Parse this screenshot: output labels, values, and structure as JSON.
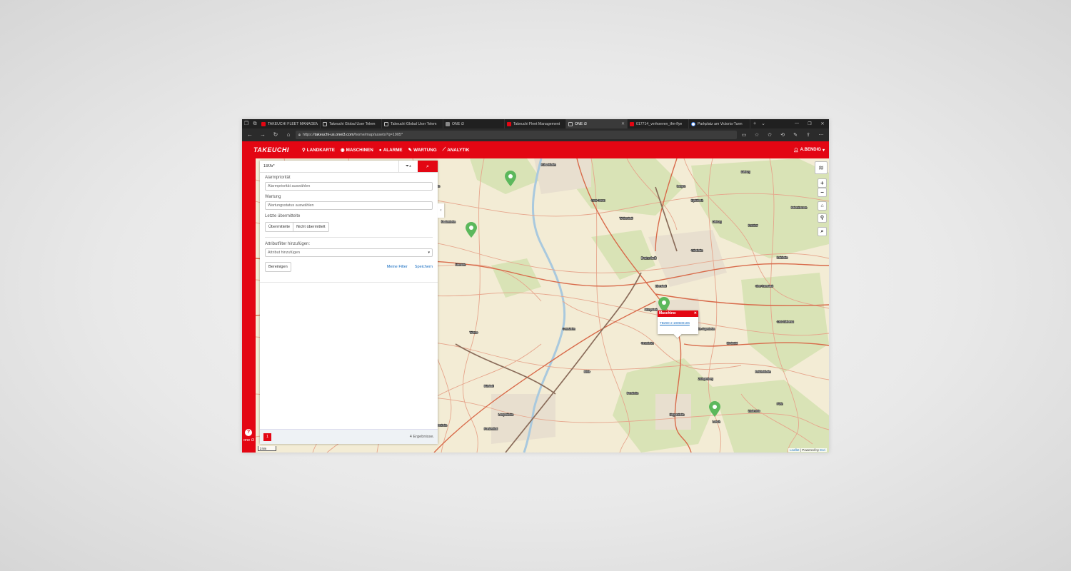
{
  "browser": {
    "tabs": [
      {
        "title": "TAKEUCHI FLEET MANAGEM",
        "favicon": "takeuchi",
        "active": false
      },
      {
        "title": "Takeuchi Global User Telem",
        "favicon": "page",
        "active": false
      },
      {
        "title": "Takeuchi Global User Telem",
        "favicon": "page",
        "active": false
      },
      {
        "title": "ONE i3",
        "favicon": "one",
        "active": false
      },
      {
        "title": "Takeuchi Fleet Management",
        "favicon": "takeuchi",
        "active": false
      },
      {
        "title": "ONE i3",
        "favicon": "page",
        "active": true
      },
      {
        "title": "017714_verhoeven_tfm-flye",
        "favicon": "takeuchi",
        "active": false
      },
      {
        "title": "Parkplatz am Victoria-Turm",
        "favicon": "google",
        "active": false
      }
    ],
    "url_prefix": "https://",
    "url_host": "takeuchi-us.onei3.com",
    "url_path": "/home/map/assets?q=1905*"
  },
  "app": {
    "logo": "TAKEUCHI",
    "menu": [
      {
        "label": "LANDKARTE",
        "icon": "map-marker-icon"
      },
      {
        "label": "MASCHINEN",
        "icon": "machine-icon"
      },
      {
        "label": "ALARME",
        "icon": "alert-icon"
      },
      {
        "label": "WARTUNG",
        "icon": "wrench-icon"
      },
      {
        "label": "ANALYTIK",
        "icon": "chart-icon"
      }
    ],
    "user": "A.BENDIG",
    "footer_logo": "one i3"
  },
  "filter": {
    "search_value": "1905*",
    "alarm_label": "Alarmpriorität",
    "alarm_placeholder": "Alarmpriorität auswählen",
    "maintenance_label": "Wartung",
    "maintenance_placeholder": "Wartungsstatus auswählen",
    "last_label": "Letzte übermittelte",
    "seg_sent": "Übermittelte",
    "seg_not_sent": "Nicht übermittelt",
    "attr_label": "Attributfilter hinzufügen:",
    "attr_placeholder": "Attribut hinzufügen",
    "clear": "Bereinigen",
    "my_filters": "Meine Filter",
    "save": "Speichern",
    "page": "1",
    "result_count": "4 Ergebnisse."
  },
  "popup": {
    "title": "Maschine:",
    "link": "TB290-2 190500106"
  },
  "map": {
    "attribution_leaflet": "Leaflet",
    "attribution_sep": "| Powered by",
    "attribution_esri": "Esri",
    "scale": "3 km"
  },
  "colors": {
    "brand": "#e30613",
    "pin": "#5cb85c",
    "link": "#1a6fc2"
  }
}
